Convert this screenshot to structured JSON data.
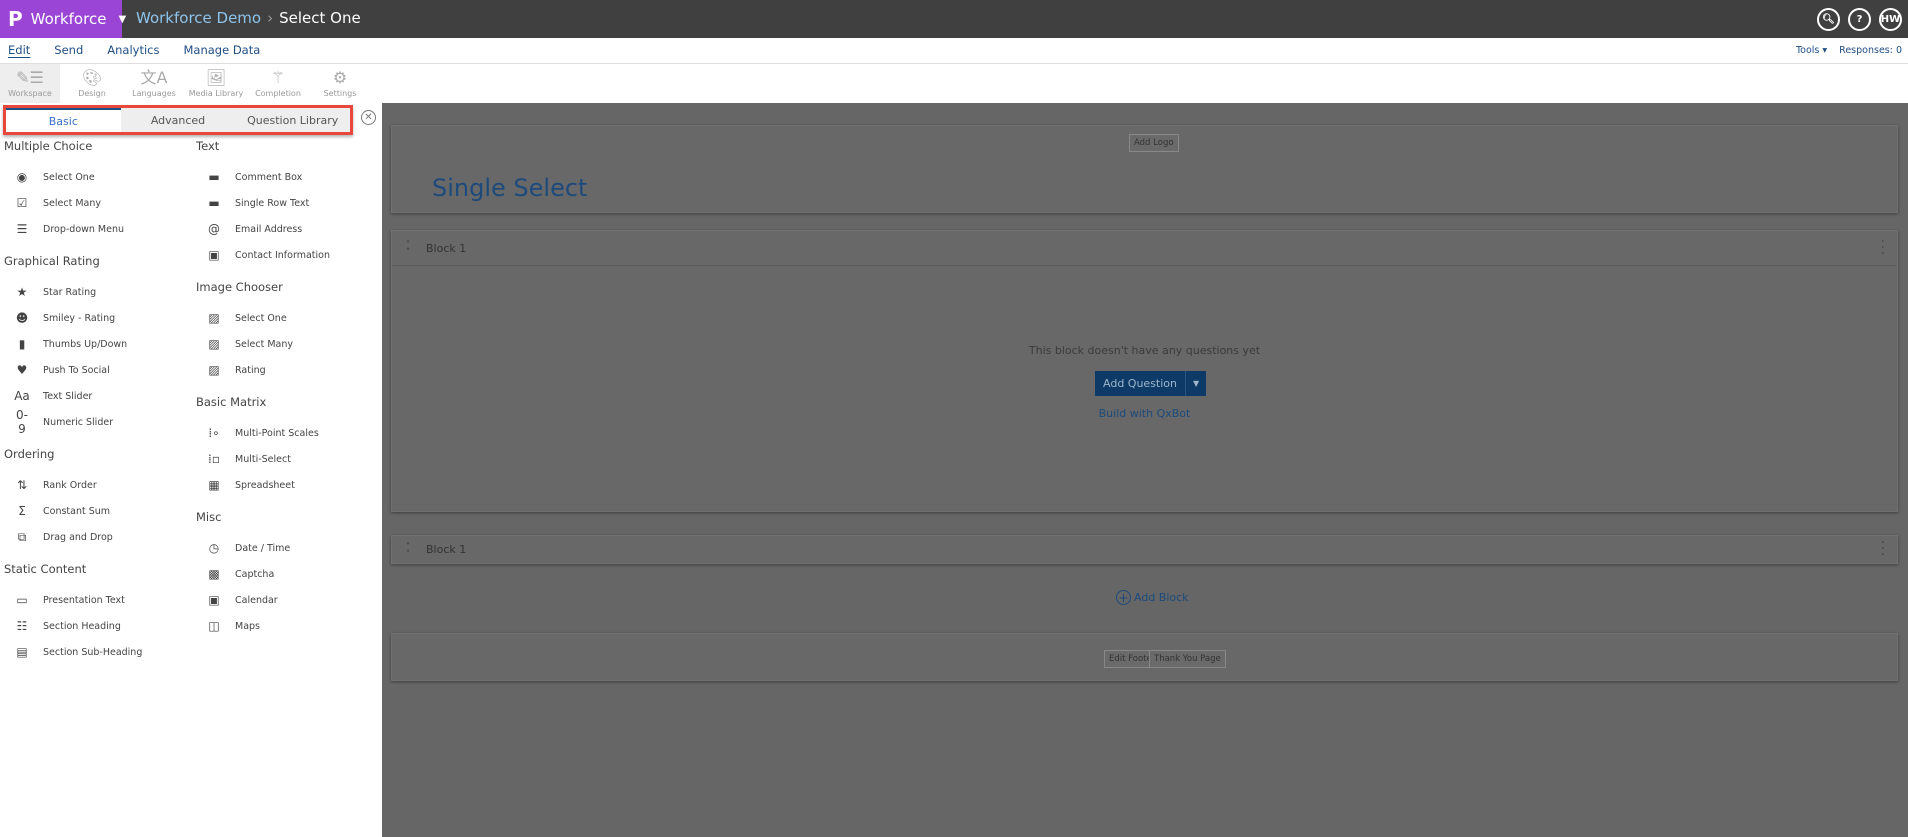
{
  "topbar": {
    "brand": "Workforce",
    "breadcrumb_project": "Workforce Demo",
    "breadcrumb_current": "Select One",
    "user_initials": "HW"
  },
  "menu": {
    "items": [
      "Edit",
      "Send",
      "Analytics",
      "Manage Data"
    ],
    "tools": "Tools ▾",
    "responses": "Responses: 0"
  },
  "toolbar": [
    {
      "label": "Workspace",
      "icon": "workspace-icon"
    },
    {
      "label": "Design",
      "icon": "palette-icon"
    },
    {
      "label": "Languages",
      "icon": "languages-icon"
    },
    {
      "label": "Media Library",
      "icon": "image-icon"
    },
    {
      "label": "Completion",
      "icon": "magic-wand-icon"
    },
    {
      "label": "Settings",
      "icon": "gear-icon"
    }
  ],
  "sidebar": {
    "tabs": [
      "Basic",
      "Advanced",
      "Question Library"
    ],
    "left": [
      {
        "heading": "Multiple Choice",
        "items": [
          {
            "label": "Select One",
            "g": "◉"
          },
          {
            "label": "Select Many",
            "g": "☑"
          },
          {
            "label": "Drop-down Menu",
            "g": "☰"
          }
        ]
      },
      {
        "heading": "Graphical Rating",
        "items": [
          {
            "label": "Star Rating",
            "g": "★"
          },
          {
            "label": "Smiley - Rating",
            "g": "☻"
          },
          {
            "label": "Thumbs Up/Down",
            "g": "▮"
          },
          {
            "label": "Push To Social",
            "g": "♥"
          },
          {
            "label": "Text Slider",
            "g": "Aa"
          },
          {
            "label": "Numeric Slider",
            "g": "0-9"
          }
        ]
      },
      {
        "heading": "Ordering",
        "items": [
          {
            "label": "Rank Order",
            "g": "⇅"
          },
          {
            "label": "Constant Sum",
            "g": "Σ"
          },
          {
            "label": "Drag and Drop",
            "g": "⧉"
          }
        ]
      },
      {
        "heading": "Static Content",
        "items": [
          {
            "label": "Presentation Text",
            "g": "▭"
          },
          {
            "label": "Section Heading",
            "g": "☷"
          },
          {
            "label": "Section Sub-Heading",
            "g": "▤"
          }
        ]
      }
    ],
    "right": [
      {
        "heading": "Text",
        "items": [
          {
            "label": "Comment Box",
            "g": "▬"
          },
          {
            "label": "Single Row Text",
            "g": "▬"
          },
          {
            "label": "Email Address",
            "g": "@"
          },
          {
            "label": "Contact Information",
            "g": "▣"
          }
        ]
      },
      {
        "heading": "Image Chooser",
        "items": [
          {
            "label": "Select One",
            "g": "▨"
          },
          {
            "label": "Select Many",
            "g": "▨"
          },
          {
            "label": "Rating",
            "g": "▨"
          }
        ]
      },
      {
        "heading": "Basic Matrix",
        "items": [
          {
            "label": "Multi-Point Scales",
            "g": "⁞∘"
          },
          {
            "label": "Multi-Select",
            "g": "⁞▫"
          },
          {
            "label": "Spreadsheet",
            "g": "▦"
          }
        ]
      },
      {
        "heading": "Misc",
        "items": [
          {
            "label": "Date / Time",
            "g": "◷"
          },
          {
            "label": "Captcha",
            "g": "▩"
          },
          {
            "label": "Calendar",
            "g": "▣"
          },
          {
            "label": "Maps",
            "g": "◫"
          }
        ]
      }
    ]
  },
  "survey": {
    "add_logo": "Add Logo",
    "title": "Single Select",
    "block1": "Block 1",
    "block2": "Block 1",
    "empty": "This block doesn't have any questions yet",
    "add_question": "Add Question",
    "qxbot": "Build with QxBot",
    "add_block": "Add Block",
    "edit_footer": "Edit Footer",
    "thank_you": "Thank You Page"
  }
}
